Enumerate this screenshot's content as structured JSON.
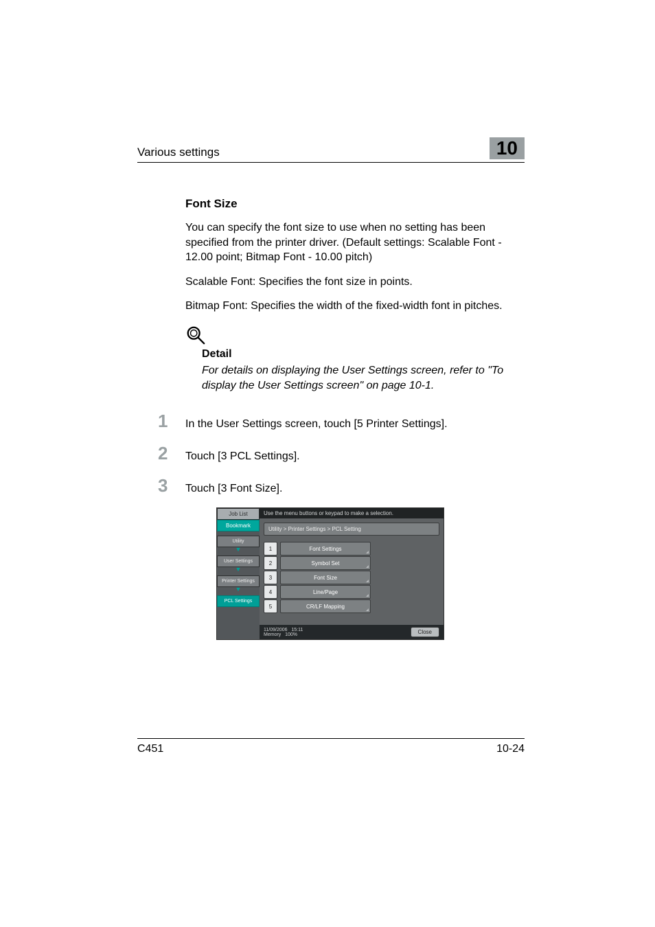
{
  "header": {
    "section_title": "Various settings",
    "chapter_number": "10"
  },
  "heading": "Font Size",
  "para1": "You can specify the font size to use when no setting has been specified from the printer driver. (Default settings: Scalable Font - 12.00 point; Bitmap Font - 10.00 pitch)",
  "para2": "Scalable Font: Specifies the font size in points.",
  "para3": "Bitmap Font: Specifies the width of the fixed-width font in pitches.",
  "detail": {
    "label": "Detail",
    "text": "For details on displaying the User Settings screen, refer to \"To display the User Settings screen\" on page 10-1."
  },
  "steps": [
    {
      "n": "1",
      "t": "In the User Settings screen, touch [5 Printer Settings]."
    },
    {
      "n": "2",
      "t": "Touch [3 PCL Settings]."
    },
    {
      "n": "3",
      "t": "Touch [3 Font Size]."
    }
  ],
  "screen": {
    "tab_job_list": "Job List",
    "tab_bookmark": "Bookmark",
    "nav": [
      "Utility",
      "User Settings",
      "Printer Settings"
    ],
    "nav_active": "PCL Settings",
    "instruction": "Use the menu buttons or keypad to make a selection.",
    "breadcrumb": "Utility > Printer Settings > PCL Setting",
    "menu": [
      {
        "n": "1",
        "l": "Font Settings"
      },
      {
        "n": "2",
        "l": "Symbol Set"
      },
      {
        "n": "3",
        "l": "Font Size"
      },
      {
        "n": "4",
        "l": "Line/Page"
      },
      {
        "n": "5",
        "l": "CR/LF Mapping"
      }
    ],
    "status_date": "11/09/2006",
    "status_time": "15:11",
    "status_mem_label": "Memory",
    "status_mem_val": "100%",
    "close": "Close"
  },
  "footer": {
    "model": "C451",
    "page": "10-24"
  }
}
